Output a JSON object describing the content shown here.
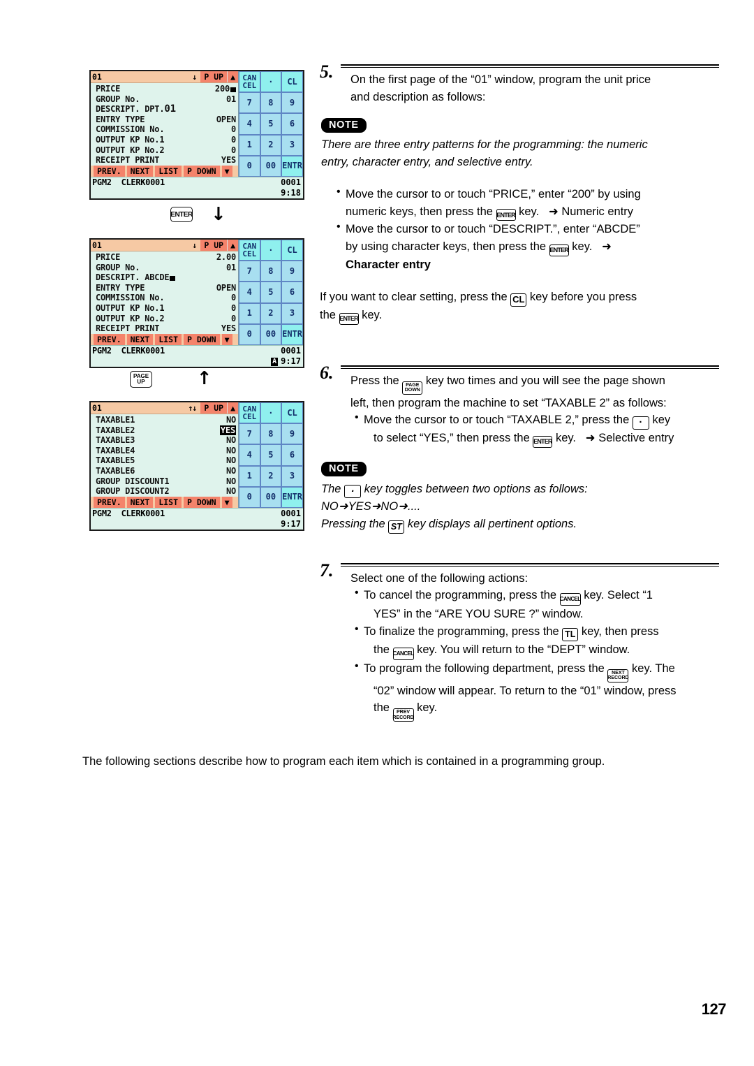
{
  "page_number": "127",
  "screens": [
    {
      "id": "screen-1",
      "title": "01",
      "title_arrows": "↓",
      "pup_label": "P UP",
      "up_arrow": "▲",
      "rows": [
        {
          "label": "PRICE",
          "value": "200",
          "caret": true
        },
        {
          "label": "GROUP No.",
          "value": "01"
        },
        {
          "label": "DESCRIPT. DPT.01",
          "value": "",
          "big": true
        },
        {
          "label": "ENTRY TYPE",
          "value": "OPEN"
        },
        {
          "label": "COMMISSION No.",
          "value": "0"
        },
        {
          "label": "OUTPUT KP No.1",
          "value": "0"
        },
        {
          "label": "OUTPUT KP No.2",
          "value": "0"
        },
        {
          "label": "RECEIPT PRINT",
          "value": "YES"
        }
      ],
      "menubar": [
        "PREV.",
        "NEXT",
        "LIST",
        "P DOWN",
        "▼"
      ],
      "status_mode": "PGM2",
      "status_clerk": "CLERK0001",
      "status_counter": "0001",
      "status_time": "9:18",
      "status_badge": ""
    },
    {
      "id": "screen-2",
      "title": "01",
      "title_arrows": "↓",
      "pup_label": "P UP",
      "up_arrow": "▲",
      "rows": [
        {
          "label": "PRICE",
          "value": "2.00"
        },
        {
          "label": "GROUP No.",
          "value": "01"
        },
        {
          "label": "DESCRIPT. ABCDE",
          "value": "",
          "caret_inline": true
        },
        {
          "label": "ENTRY TYPE",
          "value": "OPEN"
        },
        {
          "label": "COMMISSION No.",
          "value": "0"
        },
        {
          "label": "OUTPUT KP No.1",
          "value": "0"
        },
        {
          "label": "OUTPUT KP No.2",
          "value": "0"
        },
        {
          "label": "RECEIPT PRINT",
          "value": "YES"
        }
      ],
      "menubar": [
        "PREV.",
        "NEXT",
        "LIST",
        "P DOWN",
        "▼"
      ],
      "status_mode": "PGM2",
      "status_clerk": "CLERK0001",
      "status_counter": "0001",
      "status_time": "9:17",
      "status_badge": "A"
    },
    {
      "id": "screen-3",
      "title": "01",
      "title_arrows": "↑↓",
      "pup_label": "P UP",
      "up_arrow": "▲",
      "rows": [
        {
          "label": "TAXABLE1",
          "value": "NO"
        },
        {
          "label": "TAXABLE2",
          "value": "YES",
          "highlight": true
        },
        {
          "label": "TAXABLE3",
          "value": "NO"
        },
        {
          "label": "TAXABLE4",
          "value": "NO"
        },
        {
          "label": "TAXABLE5",
          "value": "NO"
        },
        {
          "label": "TAXABLE6",
          "value": "NO"
        },
        {
          "label": "GROUP DISCOUNT1",
          "value": "NO"
        },
        {
          "label": "GROUP DISCOUNT2",
          "value": "NO"
        }
      ],
      "menubar": [
        "PREV.",
        "NEXT",
        "LIST",
        "P DOWN",
        "▼"
      ],
      "status_mode": "PGM2",
      "status_clerk": "CLERK0001",
      "status_counter": "0001",
      "status_time": "9:17",
      "status_badge": ""
    }
  ],
  "keypad": [
    {
      "label": "CAN\nCEL",
      "style": "cyan"
    },
    {
      "label": "·",
      "style": "cyan"
    },
    {
      "label": "CL",
      "style": "cyan"
    },
    {
      "label": "7",
      "style": "blue"
    },
    {
      "label": "8",
      "style": "blue"
    },
    {
      "label": "9",
      "style": "blue"
    },
    {
      "label": "4",
      "style": "blue"
    },
    {
      "label": "5",
      "style": "blue"
    },
    {
      "label": "6",
      "style": "blue"
    },
    {
      "label": "1",
      "style": "blue"
    },
    {
      "label": "2",
      "style": "blue"
    },
    {
      "label": "3",
      "style": "blue"
    },
    {
      "label": "0",
      "style": "blue"
    },
    {
      "label": "00",
      "style": "blue"
    },
    {
      "label": "ENTR",
      "style": "cyan"
    }
  ],
  "flow_1": {
    "key_label": "ENTER",
    "arrow": "↓"
  },
  "flow_2": {
    "page_down_line1": "PAGE",
    "page_down_line2": "DOWN",
    "arrow_down": "↓",
    "arrow_up": "↑",
    "page_up_line1": "PAGE",
    "page_up_line2": "UP"
  },
  "steps": {
    "step5": {
      "num": "5.",
      "line1": "On the first page of the “01” window, program the unit price",
      "line2": "and description as follows:",
      "note_badge": "NOTE",
      "note_line1": "There are three entry patterns for the programming: the numeric",
      "note_line2": "entry, character entry, and selective entry.",
      "b1_l1_a": "Move the cursor to or touch “PRICE,” enter “200” by using",
      "b1_l2_a": "numeric keys, then press the",
      "b1_key": "ENTER",
      "b1_l2_b": "key.",
      "b1_arrow": "➜",
      "b1_result": "Numeric entry",
      "b2_l1_a": "Move the cursor to or touch “DESCRIPT.”, enter “ABCDE”",
      "b2_l2_a": "by using character keys, then press the",
      "b2_key": "ENTER",
      "b2_l2_b": "key.",
      "b2_arrow": "➜",
      "b2_result": "Character entry",
      "clear_l1_a": "If you want to clear setting, press the",
      "clear_key1": "CL",
      "clear_l1_b": "key before you press",
      "clear_l2_a": "the",
      "clear_key2": "ENTER",
      "clear_l2_b": "key."
    },
    "step6": {
      "num": "6.",
      "l1_a": "Press the",
      "key_pagedown_l1": "PAGE",
      "key_pagedown_l2": "DOWN",
      "l1_b": "key two times and you will see the page shown",
      "l2": "left, then program the machine to set “TAXABLE 2” as follows:",
      "b1_l1_a": "Move the cursor to or touch “TAXABLE 2,” press the",
      "b1_key": "·",
      "b1_l1_b": "key",
      "b1_l2_a": "to select “YES,” then press the",
      "b1_key2": "ENTER",
      "b1_l2_b": "key.",
      "b1_arrow": "➜",
      "b1_result": "Selective entry",
      "note_badge": "NOTE",
      "note_l1_a": "The",
      "note_key": "·",
      "note_l1_b": "key toggles between two options as follows:",
      "note_l2": "NO➜YES➜NO➜....",
      "note_l3_a": "Pressing the",
      "note_key2": "ST",
      "note_l3_b": "key displays all pertinent options."
    },
    "step7": {
      "num": "7.",
      "l1": "Select one of the following actions:",
      "b1_l1_a": "To cancel the programming, press the",
      "b1_key": "CANCEL",
      "b1_l1_b": "key. Select “1",
      "b1_l2": "YES” in the “ARE YOU SURE ?” window.",
      "b2_l1_a": "To finalize the programming, press the",
      "b2_key": "TL",
      "b2_l1_b": "key, then press",
      "b2_l2_a": "the",
      "b2_key2": "CANCEL",
      "b2_l2_b": "key. You will return to the “DEPT” window.",
      "b3_l1_a": "To program the following department, press the",
      "b3_key_l1": "NEXT",
      "b3_key_l2": "RECORD",
      "b3_l1_b": "key. The",
      "b3_l2": "“02” window will appear. To return to the “01” window, press",
      "b3_l3_a": "the",
      "b3_key2_l1": "PREV",
      "b3_key2_l2": "RECORD",
      "b3_l3_b": "key."
    }
  },
  "footer": "The following sections describe how to program each item which is contained in a programming group."
}
